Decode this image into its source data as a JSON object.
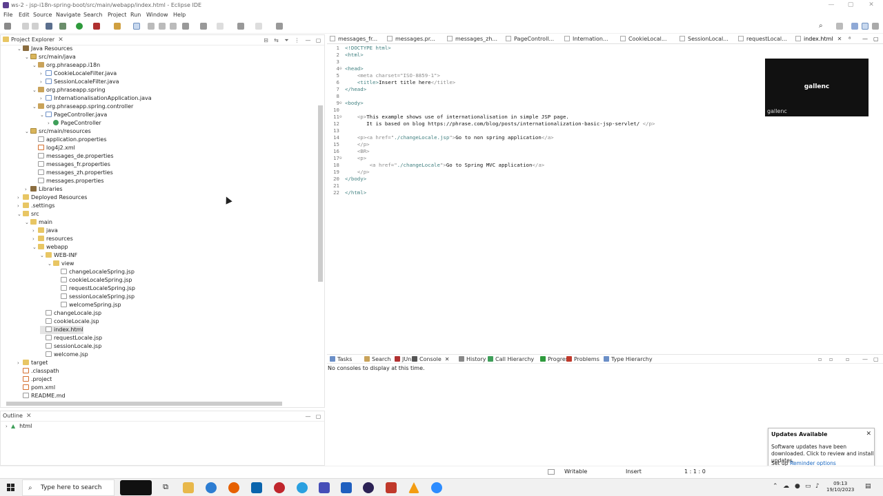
{
  "window": {
    "title": "ws-2 - jsp-i18n-spring-boot/src/main/webapp/index.html - Eclipse IDE"
  },
  "menu": [
    "File",
    "Edit",
    "Source",
    "Navigate",
    "Search",
    "Project",
    "Run",
    "Window",
    "Help"
  ],
  "project_explorer": {
    "title": "Project Explorer",
    "tree": [
      {
        "label": "Java Resources",
        "icon": "lib",
        "expanded": true
      },
      {
        "label": "src/main/java",
        "icon": "src",
        "expanded": true
      },
      {
        "label": "org.phraseapp.i18n",
        "icon": "pkg",
        "expanded": true
      },
      {
        "label": "CookieLocaleFilter.java",
        "icon": "java",
        "expanded": false
      },
      {
        "label": "SessionLocaleFilter.java",
        "icon": "java",
        "expanded": false
      },
      {
        "label": "org.phraseapp.spring",
        "icon": "pkg",
        "expanded": true
      },
      {
        "label": "InternationalisationApplication.java",
        "icon": "java",
        "expanded": false
      },
      {
        "label": "org.phraseapp.spring.controller",
        "icon": "pkg",
        "expanded": true
      },
      {
        "label": "PageController.java",
        "icon": "java",
        "expanded": true
      },
      {
        "label": "PageController",
        "icon": "class",
        "expanded": false
      },
      {
        "label": "src/main/resources",
        "icon": "src",
        "expanded": true
      },
      {
        "label": "application.properties",
        "icon": "file"
      },
      {
        "label": "log4j2.xml",
        "icon": "xml"
      },
      {
        "label": "messages_de.properties",
        "icon": "file"
      },
      {
        "label": "messages_fr.properties",
        "icon": "file"
      },
      {
        "label": "messages_zh.properties",
        "icon": "file"
      },
      {
        "label": "messages.properties",
        "icon": "file"
      },
      {
        "label": "Libraries",
        "icon": "lib",
        "expanded": false
      },
      {
        "label": "Deployed Resources",
        "icon": "folder",
        "expanded": false
      },
      {
        "label": ".settings",
        "icon": "folder",
        "expanded": false
      },
      {
        "label": "src",
        "icon": "folder",
        "expanded": true
      },
      {
        "label": "main",
        "icon": "folder",
        "expanded": true
      },
      {
        "label": "java",
        "icon": "folder",
        "expanded": false
      },
      {
        "label": "resources",
        "icon": "folder",
        "expanded": false
      },
      {
        "label": "webapp",
        "icon": "folder",
        "expanded": true
      },
      {
        "label": "WEB-INF",
        "icon": "folder",
        "expanded": true
      },
      {
        "label": "view",
        "icon": "folder",
        "expanded": true
      },
      {
        "label": "changeLocaleSpring.jsp",
        "icon": "file"
      },
      {
        "label": "cookieLocaleSpring.jsp",
        "icon": "file"
      },
      {
        "label": "requestLocaleSpring.jsp",
        "icon": "file"
      },
      {
        "label": "sessionLocaleSpring.jsp",
        "icon": "file"
      },
      {
        "label": "welcomeSpring.jsp",
        "icon": "file"
      },
      {
        "label": "changeLocale.jsp",
        "icon": "file"
      },
      {
        "label": "cookieLocale.jsp",
        "icon": "file"
      },
      {
        "label": "index.html",
        "icon": "file",
        "selected": true
      },
      {
        "label": "requestLocale.jsp",
        "icon": "file"
      },
      {
        "label": "sessionLocale.jsp",
        "icon": "file"
      },
      {
        "label": "welcome.jsp",
        "icon": "file"
      },
      {
        "label": "target",
        "icon": "folder",
        "expanded": false
      },
      {
        "label": ".classpath",
        "icon": "xml"
      },
      {
        "label": ".project",
        "icon": "xml"
      },
      {
        "label": "pom.xml",
        "icon": "xml"
      },
      {
        "label": "README.md",
        "icon": "file"
      }
    ]
  },
  "outline": {
    "title": "Outline",
    "root": "html"
  },
  "editor": {
    "tabs": [
      "messages_fr...",
      "messages.pr...",
      "messages_zh...",
      "PageControll...",
      "Internation...",
      "CookieLocal...",
      "SessionLocal...",
      "requestLocal...",
      "index.html"
    ],
    "active_tab": "index.html",
    "lines": [
      {
        "n": "1",
        "parts": [
          [
            "tag",
            "<!DOCTYPE html>"
          ]
        ]
      },
      {
        "n": "2",
        "parts": [
          [
            "tag",
            "<html>"
          ]
        ]
      },
      {
        "n": "3",
        "parts": []
      },
      {
        "n": "4",
        "fold": true,
        "parts": [
          [
            "tag",
            "<head>"
          ]
        ]
      },
      {
        "n": "5",
        "parts": [
          [
            "txt",
            "    "
          ],
          [
            "tagg",
            "<meta charset=\"ISO-8859-1\">"
          ]
        ]
      },
      {
        "n": "6",
        "parts": [
          [
            "txt",
            "    "
          ],
          [
            "tag",
            "<title>"
          ],
          [
            "txt",
            "Insert title here"
          ],
          [
            "tagg",
            "</title>"
          ]
        ]
      },
      {
        "n": "7",
        "parts": [
          [
            "tag",
            "</head>"
          ]
        ]
      },
      {
        "n": "8",
        "parts": []
      },
      {
        "n": "9",
        "fold": true,
        "parts": [
          [
            "tag",
            "<body>"
          ]
        ]
      },
      {
        "n": "10",
        "parts": []
      },
      {
        "n": "11",
        "fold": true,
        "parts": [
          [
            "txt",
            "    "
          ],
          [
            "tagg",
            "<p>"
          ],
          [
            "txt",
            "This example shows use of internationalisation in simple JSP page."
          ]
        ]
      },
      {
        "n": "12",
        "parts": [
          [
            "txt",
            "       It is based on blog https://phrase.com/blog/posts/internationalization-basic-jsp-servlet/ "
          ],
          [
            "tagg",
            "</p>"
          ]
        ]
      },
      {
        "n": "13",
        "parts": []
      },
      {
        "n": "14",
        "parts": [
          [
            "txt",
            "    "
          ],
          [
            "tagg",
            "<p><a href=\""
          ],
          [
            "tag",
            "./changeLocale.jsp"
          ],
          [
            "tagg",
            "\">"
          ],
          [
            "txt",
            "Go to non spring application"
          ],
          [
            "tagg",
            "</a>"
          ]
        ]
      },
      {
        "n": "15",
        "parts": [
          [
            "txt",
            "    "
          ],
          [
            "tagg",
            "</p>"
          ]
        ]
      },
      {
        "n": "16",
        "parts": [
          [
            "txt",
            "    "
          ],
          [
            "tagg",
            "<BR>"
          ]
        ]
      },
      {
        "n": "17",
        "fold": true,
        "parts": [
          [
            "txt",
            "    "
          ],
          [
            "tagg",
            "<p>"
          ]
        ]
      },
      {
        "n": "18",
        "parts": [
          [
            "txt",
            "        "
          ],
          [
            "tagg",
            "<a href=\""
          ],
          [
            "tag",
            "./changeLocale"
          ],
          [
            "tagg",
            "\">"
          ],
          [
            "txt",
            "Go to Spring MVC application"
          ],
          [
            "tagg",
            "</a>"
          ]
        ]
      },
      {
        "n": "19",
        "parts": [
          [
            "txt",
            "    "
          ],
          [
            "tagg",
            "</p>"
          ]
        ]
      },
      {
        "n": "20",
        "parts": [
          [
            "tag",
            "</body>"
          ]
        ]
      },
      {
        "n": "21",
        "parts": []
      },
      {
        "n": "22",
        "parts": [
          [
            "tag",
            "</html>"
          ]
        ]
      }
    ]
  },
  "video_overlay": {
    "name_big": "gallenc",
    "name_small": "gallenc"
  },
  "console": {
    "tabs": [
      "Tasks",
      "Search",
      "JUnit",
      "Console",
      "History",
      "Call Hierarchy",
      "Progress",
      "Problems",
      "Type Hierarchy"
    ],
    "active_tab": "Console",
    "message": "No consoles to display at this time."
  },
  "notification": {
    "title": "Updates Available",
    "body": "Software updates have been downloaded. Click to review and install updates.",
    "setup_prefix": "Set up",
    "link": "Reminder options"
  },
  "status": {
    "writable": "Writable",
    "insert": "Insert",
    "position": "1 : 1 : 0"
  },
  "taskbar": {
    "search_placeholder": "Type here to search",
    "time": "09:13",
    "date": "19/10/2023"
  }
}
